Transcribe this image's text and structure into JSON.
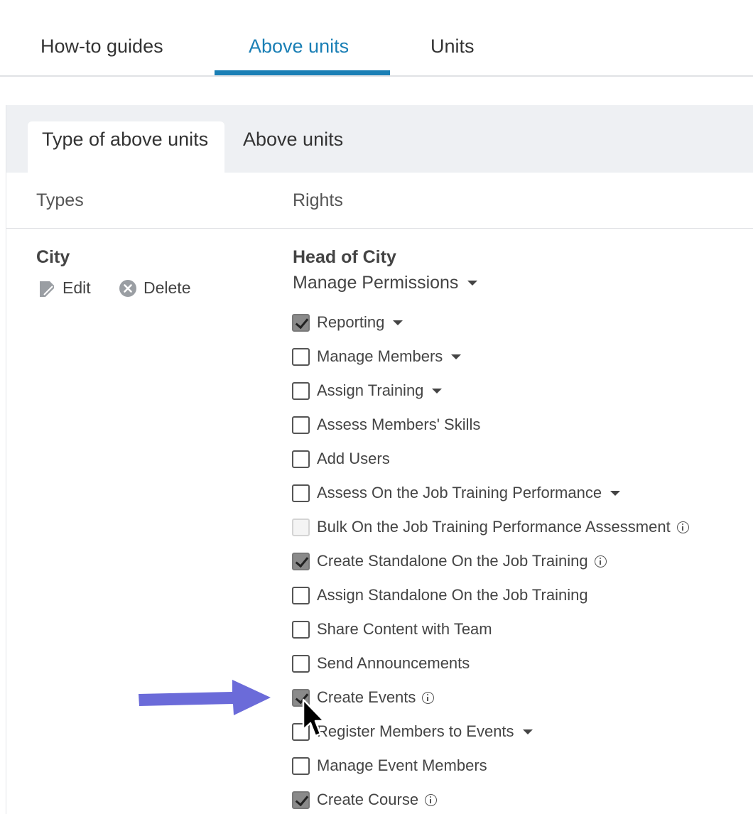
{
  "top_tabs": [
    {
      "label": "How-to guides",
      "active": false
    },
    {
      "label": "Above units",
      "active": true
    },
    {
      "label": "Units",
      "active": false
    }
  ],
  "sub_tabs": [
    {
      "label": "Type of above units",
      "active": true
    },
    {
      "label": "Above units",
      "active": false
    }
  ],
  "columns": {
    "types": "Types",
    "rights": "Rights"
  },
  "type_row": {
    "name": "City",
    "edit_label": "Edit",
    "delete_label": "Delete"
  },
  "rights": {
    "title": "Head of City",
    "manage_label": "Manage Permissions",
    "permissions": [
      {
        "label": "Reporting",
        "checked": true,
        "dropdown": true,
        "info": false,
        "disabled": false
      },
      {
        "label": "Manage Members",
        "checked": false,
        "dropdown": true,
        "info": false,
        "disabled": false
      },
      {
        "label": "Assign Training",
        "checked": false,
        "dropdown": true,
        "info": false,
        "disabled": false
      },
      {
        "label": "Assess Members' Skills",
        "checked": false,
        "dropdown": false,
        "info": false,
        "disabled": false
      },
      {
        "label": "Add Users",
        "checked": false,
        "dropdown": false,
        "info": false,
        "disabled": false
      },
      {
        "label": "Assess On the Job Training Performance",
        "checked": false,
        "dropdown": true,
        "info": false,
        "disabled": false
      },
      {
        "label": "Bulk On the Job Training Performance Assessment",
        "checked": false,
        "dropdown": false,
        "info": true,
        "disabled": true
      },
      {
        "label": "Create Standalone On the Job Training",
        "checked": true,
        "dropdown": false,
        "info": true,
        "disabled": false
      },
      {
        "label": "Assign Standalone On the Job Training",
        "checked": false,
        "dropdown": false,
        "info": false,
        "disabled": false
      },
      {
        "label": "Share Content with Team",
        "checked": false,
        "dropdown": false,
        "info": false,
        "disabled": false
      },
      {
        "label": "Send Announcements",
        "checked": false,
        "dropdown": false,
        "info": false,
        "disabled": false
      },
      {
        "label": "Create Events",
        "checked": true,
        "dropdown": false,
        "info": true,
        "disabled": false
      },
      {
        "label": "Register Members to Events",
        "checked": false,
        "dropdown": true,
        "info": false,
        "disabled": false
      },
      {
        "label": "Manage Event Members",
        "checked": false,
        "dropdown": false,
        "info": false,
        "disabled": false
      },
      {
        "label": "Create Course",
        "checked": true,
        "dropdown": false,
        "info": true,
        "disabled": false
      }
    ]
  },
  "colors": {
    "accent": "#1a7fb5",
    "arrow": "#6b6bd9",
    "header_bg": "#eef0f3"
  }
}
